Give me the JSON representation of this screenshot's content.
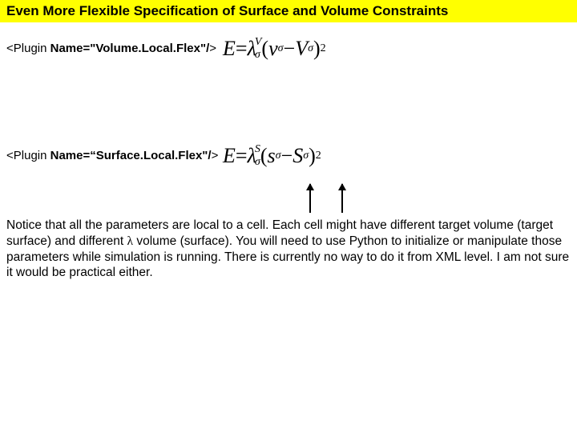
{
  "title": "Even More Flexible Specification of Surface and Volume Constraints",
  "plugin1": {
    "open": "<Plugin",
    "attr": " Name=\"Volume.Local.Flex\"/",
    "close": ">"
  },
  "plugin2": {
    "open": "<Plugin",
    "attr": " Name=“Surface.Local.Flex\"/",
    "close": ">"
  },
  "eq1": {
    "E": "E",
    "eq": " = ",
    "lam": "λ",
    "sup": "V",
    "sub": "σ",
    "lp": "(",
    "v1": "ν",
    "v1sub": "σ",
    "minus": " − ",
    "v2": "V",
    "v2sub": "σ",
    "rp": ")",
    "pow": "2"
  },
  "eq2": {
    "E": "E",
    "eq": " = ",
    "lam": "λ",
    "sup": "S",
    "sub": "σ",
    "lp": "(",
    "s1": "s",
    "s1sub": "σ",
    "minus": " − ",
    "s2": "S",
    "s2sub": "σ",
    "rp": ")",
    "pow": "2"
  },
  "body": {
    "p1a": "Notice that all the parameters are local to a cell. Each cell might have different target volume (target surface) and different ",
    "lam": "λ",
    "p1b": " volume (surface). You will need to use Python to initialize or manipulate those parameters while simulation is running. There is currently no way to do it from XML level. I am not sure it would be practical either."
  }
}
